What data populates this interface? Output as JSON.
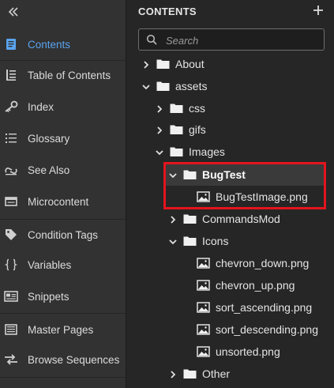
{
  "sidebar": {
    "collapse_icon": "chevron-double-left-icon",
    "accent_color": "#5aa4ee",
    "items": [
      {
        "label": "Contents",
        "icon": "contents-icon",
        "active": true
      },
      {
        "label": "Table of Contents",
        "icon": "toc-icon"
      },
      {
        "label": "Index",
        "icon": "key-icon"
      },
      {
        "label": "Glossary",
        "icon": "glossary-icon"
      },
      {
        "label": "See Also",
        "icon": "see-also-icon"
      },
      {
        "label": "Microcontent",
        "icon": "microcontent-icon"
      },
      {
        "label": "Condition Tags",
        "icon": "tag-icon"
      },
      {
        "label": "Variables",
        "icon": "braces-icon"
      },
      {
        "label": "Snippets",
        "icon": "snippet-icon"
      },
      {
        "label": "Master Pages",
        "icon": "master-pages-icon"
      },
      {
        "label": "Browse Sequences",
        "icon": "browse-sequences-icon"
      }
    ]
  },
  "panel": {
    "title": "CONTENTS",
    "add_icon": "plus-icon",
    "search": {
      "placeholder": "Search",
      "value": ""
    }
  },
  "tree": [
    {
      "label": "About",
      "type": "folder",
      "expanded": false
    },
    {
      "label": "assets",
      "type": "folder",
      "expanded": true
    },
    {
      "label": "css",
      "type": "folder",
      "expanded": false
    },
    {
      "label": "gifs",
      "type": "folder",
      "expanded": false
    },
    {
      "label": "Images",
      "type": "folder",
      "expanded": true
    },
    {
      "label": "BugTest",
      "type": "folder",
      "expanded": true,
      "selected": true
    },
    {
      "label": "BugTestImage.png",
      "type": "image"
    },
    {
      "label": "CommandsMod",
      "type": "folder",
      "expanded": false
    },
    {
      "label": "Icons",
      "type": "folder",
      "expanded": true
    },
    {
      "label": "chevron_down.png",
      "type": "image"
    },
    {
      "label": "chevron_up.png",
      "type": "image"
    },
    {
      "label": "sort_ascending.png",
      "type": "image"
    },
    {
      "label": "sort_descending.png",
      "type": "image"
    },
    {
      "label": "unsorted.png",
      "type": "image"
    },
    {
      "label": "Other",
      "type": "folder",
      "expanded": false
    }
  ],
  "highlight_color": "#e3141e"
}
